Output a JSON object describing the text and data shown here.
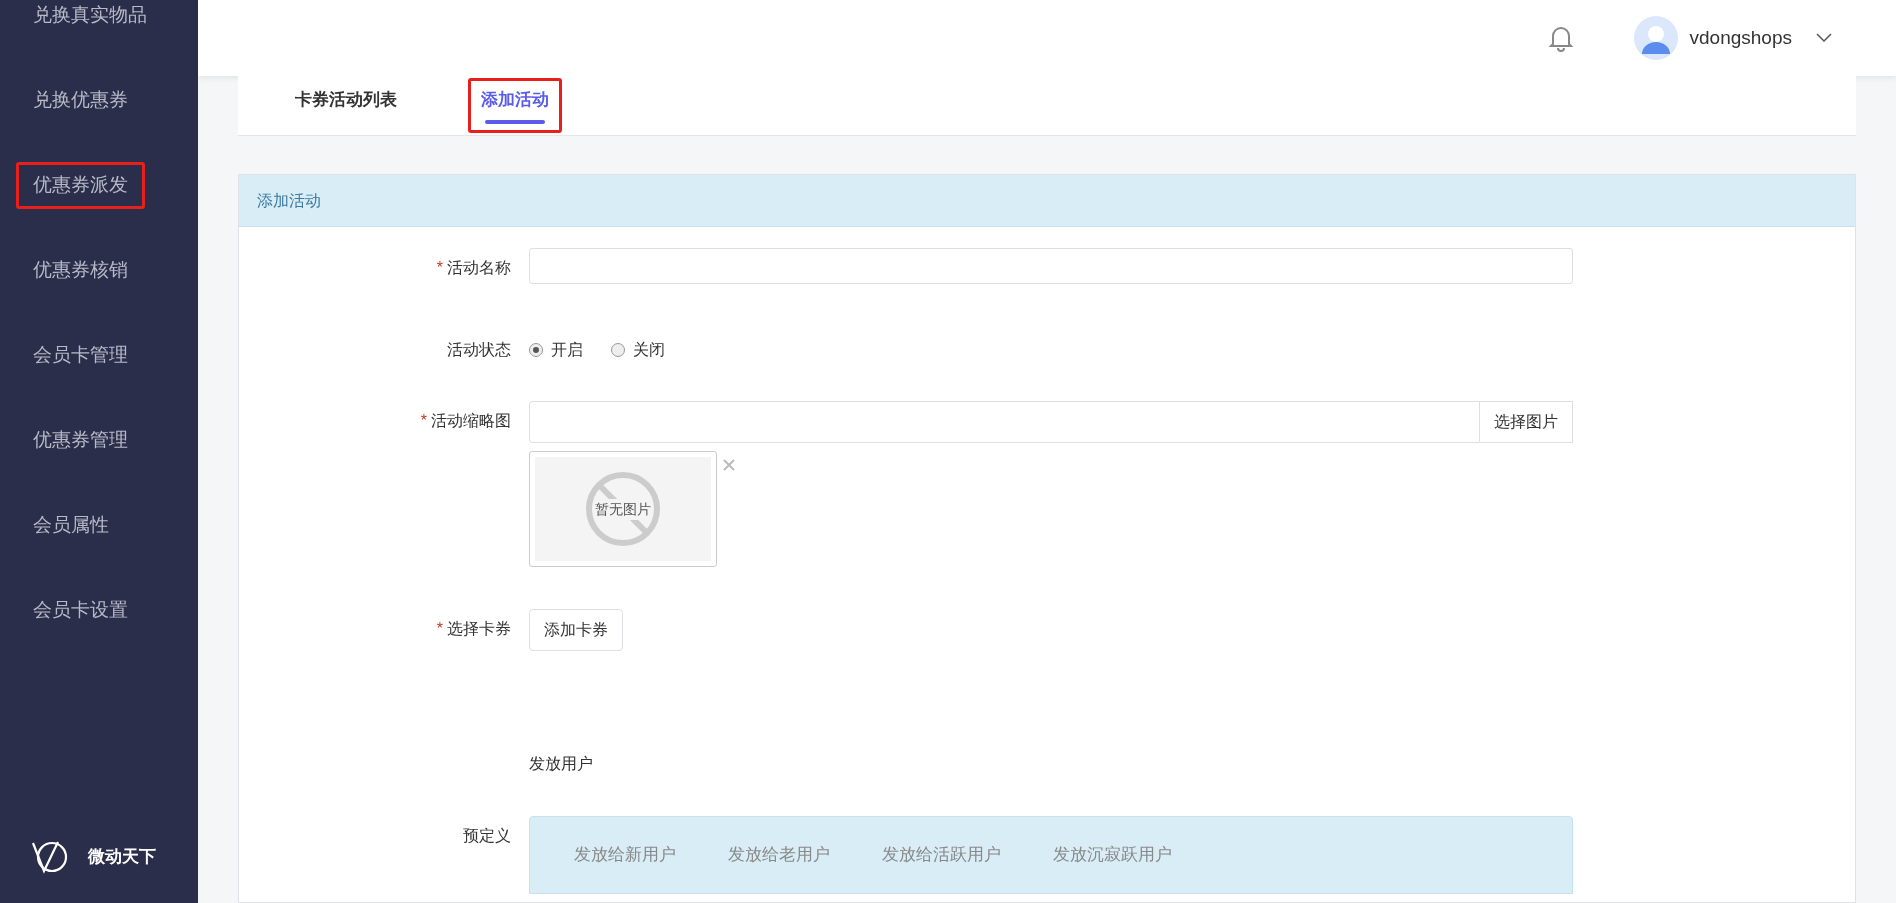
{
  "sidebar": {
    "items": [
      {
        "label": "兑换真实物品",
        "selected": false,
        "highlighted": false
      },
      {
        "label": "兑换优惠券",
        "selected": false,
        "highlighted": false
      },
      {
        "label": "优惠券派发",
        "selected": false,
        "highlighted": true
      },
      {
        "label": "优惠券核销",
        "selected": false,
        "highlighted": false
      },
      {
        "label": "会员卡管理",
        "selected": false,
        "highlighted": false
      },
      {
        "label": "优惠券管理",
        "selected": false,
        "highlighted": false
      },
      {
        "label": "会员属性",
        "selected": false,
        "highlighted": false
      },
      {
        "label": "会员卡设置",
        "selected": false,
        "highlighted": false
      }
    ],
    "brand": "微动天下"
  },
  "header": {
    "username": "vdongshops"
  },
  "tabs": [
    {
      "label": "卡券活动列表",
      "selected": false,
      "highlighted": false
    },
    {
      "label": "添加活动",
      "selected": true,
      "highlighted": true
    }
  ],
  "panel": {
    "title": "添加活动",
    "fields": [
      {
        "kind": "text",
        "label": "活动名称",
        "required_mark": "*"
      },
      {
        "kind": "radio",
        "label": "活动状态",
        "options": [
          {
            "label": "开启",
            "selected": true
          },
          {
            "label": "关闭",
            "selected": false
          }
        ]
      },
      {
        "kind": "image",
        "label": "活动缩略图",
        "required_mark": "*",
        "button": "选择图片",
        "image_text": "暂无图片"
      },
      {
        "kind": "button",
        "label": "选择卡券",
        "required_mark": "*",
        "button": "添加卡券"
      }
    ],
    "section_label": "发放用户",
    "predefined": {
      "label": "预定义",
      "tabs": [
        {
          "label": "发放给新用户"
        },
        {
          "label": "发放给老用户"
        },
        {
          "label": "发放给活跃用户"
        },
        {
          "label": "发放沉寂跃用户"
        }
      ]
    }
  }
}
